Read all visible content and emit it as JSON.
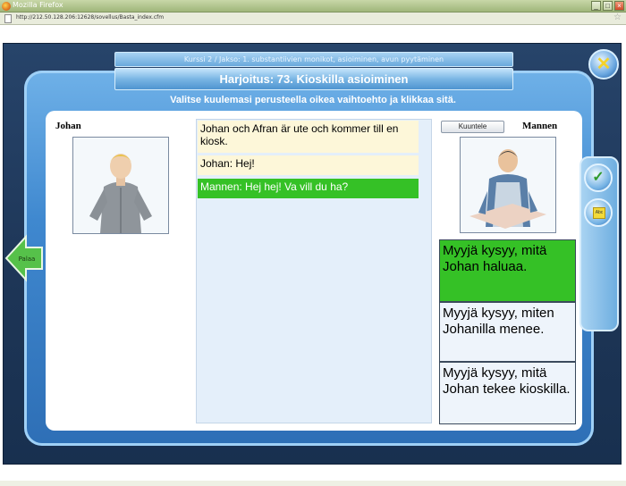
{
  "browser": {
    "window_title": "Mozilla Firefox",
    "url": "http://212.50.128.206:12628/sovellus/Basta_index.cfm"
  },
  "header": {
    "subtitle": "Kurssi 2 / Jakso: 1. substantiivien monikot, asioiminen, avun pyytäminen",
    "title": "Harjoitus: 73. Kioskilla asioiminen",
    "instruction": "Valitse kuulemasi perusteella oikea vaihtoehto ja klikkaa sitä."
  },
  "characters": {
    "left_name": "Johan",
    "right_name": "Mannen"
  },
  "dialog": {
    "lines": [
      "Johan och Afran är ute och kommer till en kiosk.",
      "Johan: Hej!",
      "Mannen: Hej hej! Va vill du ha?"
    ]
  },
  "controls": {
    "listen_label": "Kuuntele",
    "back_label": "Palaa",
    "close_symbol": "✕",
    "check_symbol": "✓",
    "dictionary_symbol": "Abc"
  },
  "options": [
    "Myyjä kysyy, mitä Johan haluaa.",
    "Myyjä kysyy, miten Johanilla menee.",
    "Myyjä kysyy, mitä Johan tekee kioskilla."
  ],
  "colors": {
    "selected_option": "#35c126",
    "active_line": "#35c126",
    "frame_blue": "#3f88cf",
    "stage_dark": "#1d3556"
  }
}
